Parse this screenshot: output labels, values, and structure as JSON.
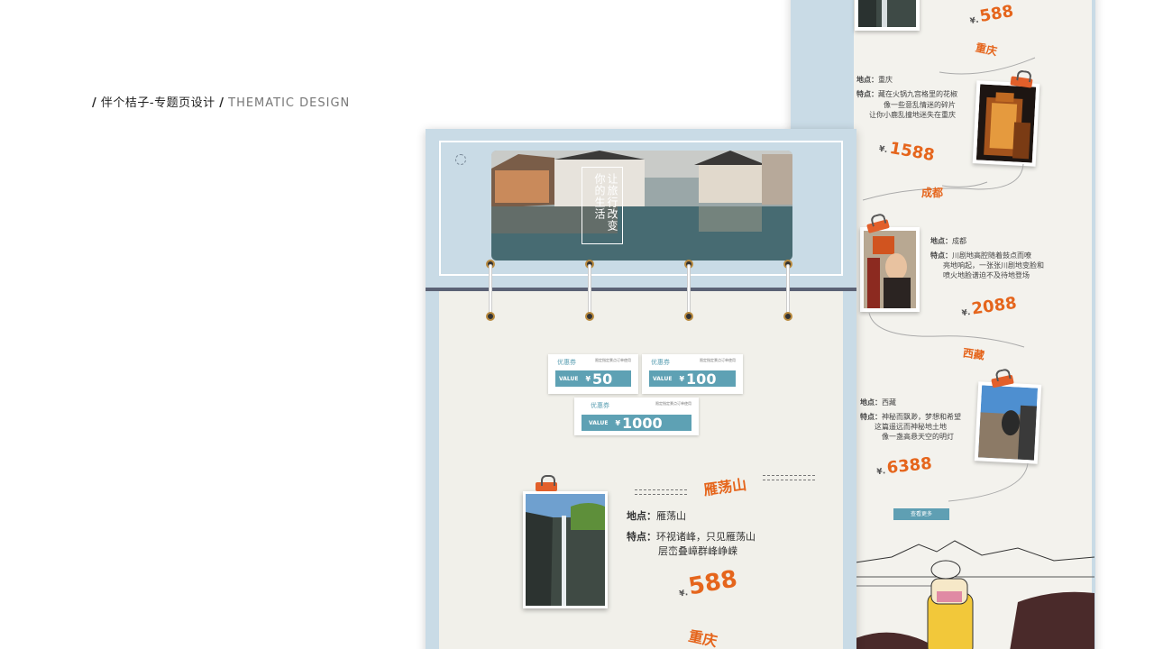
{
  "header": {
    "slash": "/",
    "title_cn": "伴个桔子-专题页设计",
    "title_en": "THEMATIC DESIGN"
  },
  "banner": {
    "title": "让旅行改变你的生活"
  },
  "coupons": [
    {
      "title": "优惠券",
      "note": "限定指定景点订单使用",
      "value_label": "VALUE",
      "currency": "¥",
      "amount": "50"
    },
    {
      "title": "优惠券",
      "note": "限定指定景点订单使用",
      "value_label": "VALUE",
      "currency": "¥",
      "amount": "100"
    },
    {
      "title": "优惠券",
      "note": "限定指定景点订单使用",
      "value_label": "VALUE",
      "currency": "¥",
      "amount": "1000"
    }
  ],
  "front_destination": {
    "name": "雁荡山",
    "location_label": "地点：",
    "location": "雁荡山",
    "feature_label": "特点：",
    "feature_line1": "环视诸峰，只见雁荡山",
    "feature_line2": "层峦叠嶂群峰峥嵘",
    "currency": "¥.",
    "price": "588",
    "next_city": "重庆"
  },
  "back_destinations": [
    {
      "currency": "¥.",
      "price": "588",
      "next_city": "重庆"
    },
    {
      "location_label": "地点：",
      "location": "重庆",
      "feature_label": "特点：",
      "feature_lines": [
        "藏在火锅九宫格里的花椒",
        "像一些意乱情迷的碎片",
        "让你小鹿乱撞地迷失在重庆"
      ],
      "currency": "¥.",
      "price": "1588",
      "next_city": "成都"
    },
    {
      "location_label": "地点：",
      "location": "成都",
      "feature_label": "特点：",
      "feature_lines": [
        "川剧地高腔随着鼓点而嘹",
        "亮地响起，一张张川剧地变脸和",
        "喷火地脸谱迫不及待地登场"
      ],
      "currency": "¥.",
      "price": "2088",
      "next_city": "西藏"
    },
    {
      "location_label": "地点：",
      "location": "西藏",
      "feature_label": "特点：",
      "feature_lines": [
        "神秘而飘渺，梦想和希望",
        "这篇遥远而神秘地土地",
        "像一盏高悬天空的明灯"
      ],
      "currency": "¥.",
      "price": "6388"
    }
  ],
  "more_button": "查看更多",
  "colors": {
    "accent_orange": "#e5651c",
    "page_blue": "#c9dbe6",
    "paper": "#f1f0ea",
    "coupon_teal": "#5ea1b4",
    "divider_navy": "#5b6275"
  }
}
